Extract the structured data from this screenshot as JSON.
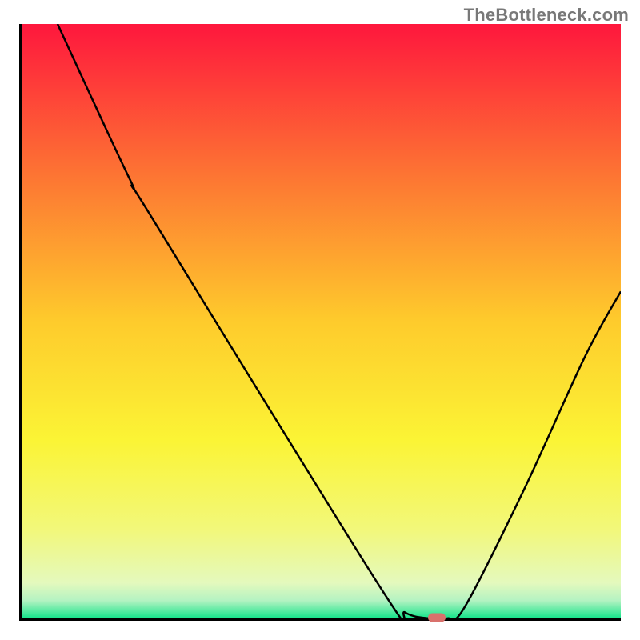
{
  "watermark": "TheBottleneck.com",
  "chart_data": {
    "type": "line",
    "title": "",
    "xlabel": "",
    "ylabel": "",
    "xlim": [
      0,
      100
    ],
    "ylim": [
      0,
      100
    ],
    "grid": false,
    "legend": false,
    "gradient_stops": [
      {
        "offset": 0,
        "color": "#fe173d"
      },
      {
        "offset": 25,
        "color": "#fd7333"
      },
      {
        "offset": 50,
        "color": "#fecb2c"
      },
      {
        "offset": 70,
        "color": "#fbf435"
      },
      {
        "offset": 85,
        "color": "#f2f87a"
      },
      {
        "offset": 94,
        "color": "#e4f9bd"
      },
      {
        "offset": 97,
        "color": "#b4f3c2"
      },
      {
        "offset": 100,
        "color": "#13e389"
      }
    ],
    "curve_points": [
      {
        "x": 6,
        "y": 100
      },
      {
        "x": 18,
        "y": 74
      },
      {
        "x": 22,
        "y": 67
      },
      {
        "x": 60,
        "y": 5
      },
      {
        "x": 64,
        "y": 1
      },
      {
        "x": 68,
        "y": 0
      },
      {
        "x": 71,
        "y": 0
      },
      {
        "x": 74,
        "y": 2
      },
      {
        "x": 84,
        "y": 22
      },
      {
        "x": 94,
        "y": 44
      },
      {
        "x": 100,
        "y": 55
      }
    ],
    "marker": {
      "x": 69,
      "y": 0.5,
      "color": "#d9716c"
    },
    "annotations": []
  }
}
